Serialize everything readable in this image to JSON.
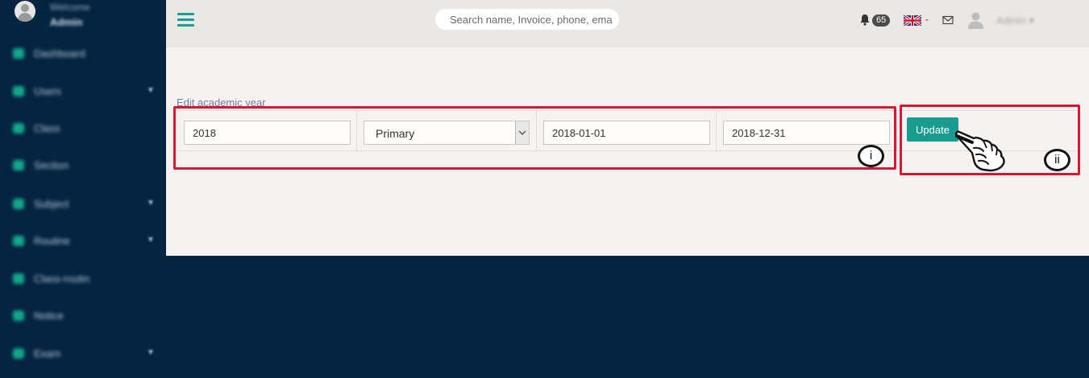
{
  "sidebar": {
    "welcome": "Welcome",
    "user_name": "Admin",
    "items": [
      {
        "label": "Dashboard",
        "icon": "dashboard-icon",
        "has_children": false
      },
      {
        "label": "Users",
        "icon": "users-icon",
        "has_children": true
      },
      {
        "label": "Class",
        "icon": "class-icon",
        "has_children": false
      },
      {
        "label": "Section",
        "icon": "section-icon",
        "has_children": false
      },
      {
        "label": "Subject",
        "icon": "subject-icon",
        "has_children": true
      },
      {
        "label": "Routine",
        "icon": "routine-icon",
        "has_children": true
      },
      {
        "label": "Class-routin",
        "icon": "class-routine-icon",
        "has_children": false
      },
      {
        "label": "Notice",
        "icon": "notice-icon",
        "has_children": false
      },
      {
        "label": "Exam",
        "icon": "exam-icon",
        "has_children": true
      }
    ]
  },
  "topbar": {
    "search_placeholder": "Search name, Invoice, phone, ema",
    "notification_count": "65",
    "language_icon": "uk-flag-icon",
    "admin_label": "Admin ▾"
  },
  "form": {
    "title": "Edit academic year",
    "year_value": "2018",
    "level_value": "Primary",
    "start_date": "2018-01-01",
    "end_date": "2018-12-31",
    "update_label": "Update"
  },
  "annotations": {
    "label_i": "i",
    "label_ii": "ii",
    "color": "#d61634"
  },
  "colors": {
    "sidebar_bg": "#052441",
    "accent": "#1a9b8f",
    "content_bg": "#f6f2ef"
  }
}
